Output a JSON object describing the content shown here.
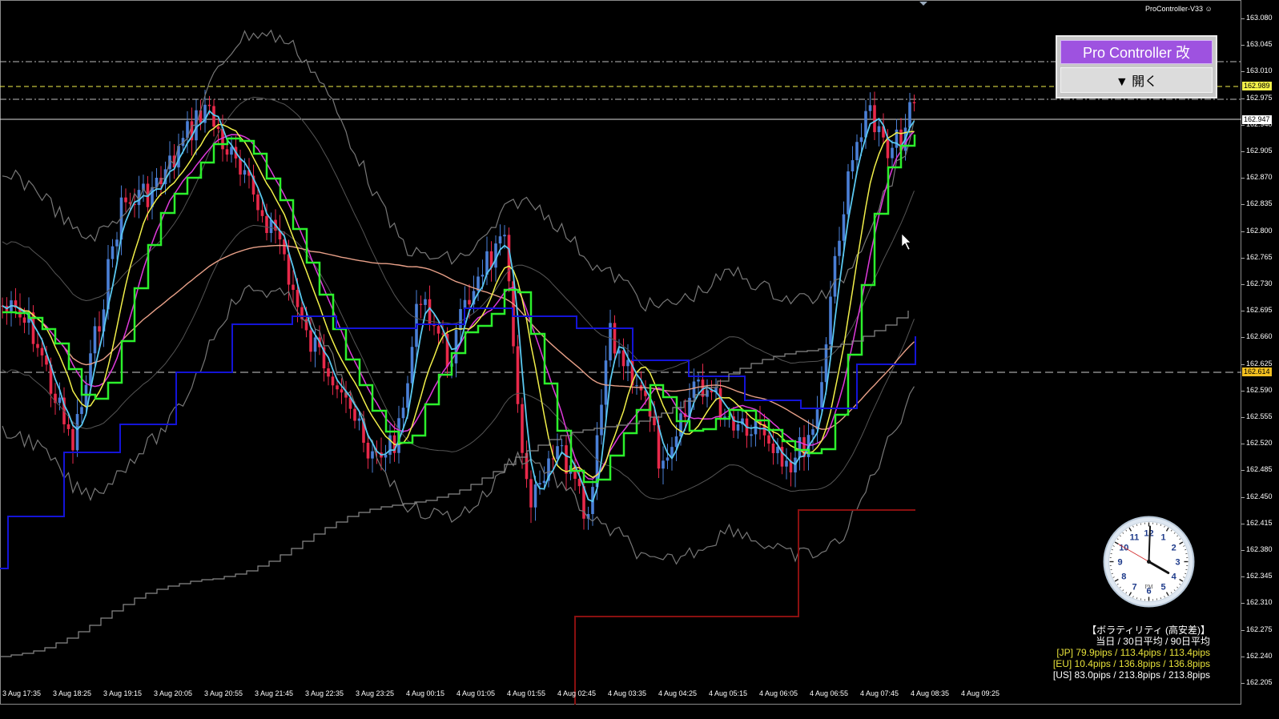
{
  "indicator_label": "ProController-V33",
  "controller": {
    "title": "Pro Controller 改",
    "open_label": "▼ 開く"
  },
  "yaxis": {
    "ticks": [
      "163.080",
      "163.045",
      "163.010",
      "162.975",
      "162.940",
      "162.905",
      "162.870",
      "162.835",
      "162.800",
      "162.765",
      "162.730",
      "162.695",
      "162.660",
      "162.625",
      "162.590",
      "162.555",
      "162.520",
      "162.485",
      "162.450",
      "162.415",
      "162.380",
      "162.345",
      "162.310",
      "162.275",
      "162.240",
      "162.205"
    ],
    "tag_yellow": "162.989",
    "tag_white": "162.947",
    "tag_gold": "162.614"
  },
  "xaxis": {
    "ticks": [
      "3 Aug 17:35",
      "3 Aug 18:25",
      "3 Aug 19:15",
      "3 Aug 20:05",
      "3 Aug 20:55",
      "3 Aug 21:45",
      "3 Aug 22:35",
      "3 Aug 23:25",
      "4 Aug 00:15",
      "4 Aug 01:05",
      "4 Aug 01:55",
      "4 Aug 02:45",
      "4 Aug 03:35",
      "4 Aug 04:25",
      "4 Aug 05:15",
      "4 Aug 06:05",
      "4 Aug 06:55",
      "4 Aug 07:45",
      "4 Aug 08:35",
      "4 Aug 09:25"
    ]
  },
  "volatility": {
    "title": "【ボラティリティ (高安差)】",
    "header": "当日 / 30日平均 / 90日平均",
    "rows": [
      {
        "text": "[JP] 79.9pips / 113.4pips / 113.4pips",
        "color": "#e8e23a"
      },
      {
        "text": "[EU] 10.4pips / 136.8pips / 136.8pips",
        "color": "#e8e23a"
      },
      {
        "text": "[US] 83.0pips / 213.8pips / 213.8pips",
        "color": "#ffffff"
      }
    ]
  },
  "clock": {
    "numbers": [
      "12",
      "1",
      "2",
      "3",
      "4",
      "5",
      "6",
      "7",
      "8",
      "9",
      "10",
      "11"
    ],
    "ampm": "PM"
  },
  "colors": {
    "bull": "#4a7fd6",
    "bear": "#e8294a",
    "ma_fast": "#5ac8f0",
    "ma_yellow": "#f2f04a",
    "ma_magenta": "#e03adc",
    "ma_green": "#2cf02c",
    "ma_salmon": "#e8a088",
    "step_blue": "#1414d8",
    "step_red": "#8a1010",
    "band": "#8a8a8a"
  }
}
